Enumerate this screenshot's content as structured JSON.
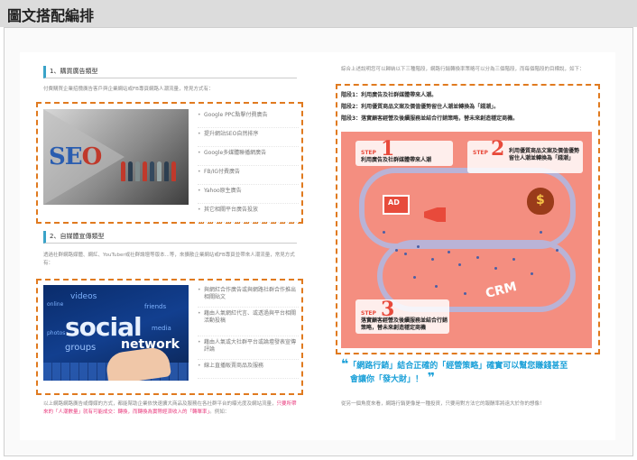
{
  "header": {
    "title": "圖文搭配編排"
  },
  "left": {
    "section1": {
      "title": "1、購買廣告類型",
      "intro": "付費購買企業招攬廣告客戶與企業網站或FB專頁網路人潮流量，常見方式有：",
      "items": [
        "Google PPC點擊付費廣告",
        "提升網站SEO自然排序",
        "Google多媒體聯播網廣告",
        "FB/IG付費廣告",
        "Yahoo原生廣告",
        "其它相關平台廣告投放"
      ]
    },
    "section2": {
      "title": "2、自媒體宣傳類型",
      "intro": "透過社群網路媒體、網紅、YouTuber或社群論壇等版本...等，來擴散企業網站或FB專頁並帶來人潮流量，常見方式有：",
      "items": [
        "與網紅合作廣告或與網路社群合作推出相關貼文",
        "藉由人氣網紅代言、或透過與平台相關活動投稿",
        "藉由人氣或大社群平台或論壇發表宣傳評論",
        "線上直播販賣商品及服務"
      ]
    },
    "footer_text": "以上網路網路廣告或傳媒的方式，都能幫助企業依快速擴大商品及服務在各社群平台的曝光度及網站流量，",
    "footer_pink": "只要所帶來的「人潮數量」就有可能成交：轉換，而轉換為實際經濟收入的「轉單率」",
    "footer_end": "。例如：",
    "seo_image": {
      "word_blue": "SE",
      "word_red": "O"
    },
    "social_image": {
      "big_word": "social",
      "net_word": "network",
      "words": [
        "videos",
        "online",
        "friends",
        "groups",
        "media",
        "photos"
      ]
    }
  },
  "right": {
    "intro": "綜合上述說明您可以歸納以下三種階段，網路行銷轉換率策略可以分為三個階段，而每個階段的目標說，如下：",
    "stages": [
      "階段1：利用廣告及社群媒體帶來人潮。",
      "階段2：利用優質商品文案及價值優勢留住人潮並轉換為「錢潮」。",
      "階段3：落實顧客經營及後續服務並結合行銷策略，替未來創造穩定商機。"
    ],
    "infographic": {
      "step1_label": "STEP",
      "step1_num": "1",
      "step1_text": "利用廣告及社群媒體帶來人潮",
      "step2_label": "STEP",
      "step2_num": "2",
      "step2_text": "利用優質商品文案及價值優勢留住人潮並轉換為「錢潮」",
      "step3_label": "STEP",
      "step3_num": "3",
      "step3_text": "落實顧客經營及後續服務並結合行銷策略，替未來創造穩定商機",
      "ad": "AD",
      "crm": "CRM",
      "coin": "$"
    },
    "quote_line1": "「網路行銷」結合正確的「經營策略」確實可以幫您賺錢甚至",
    "quote_line2": "會讓你「發大財」！",
    "closing": "從另一個角度來看，網路行銷更像是一種投資，只要用對方法它的報酬率將遠大於你的想像！"
  },
  "colors": {
    "accent_orange": "#e07a1f",
    "accent_blue": "#1aa0d8",
    "accent_pink": "#e8397c",
    "infographic_bg": "#f48e80"
  }
}
